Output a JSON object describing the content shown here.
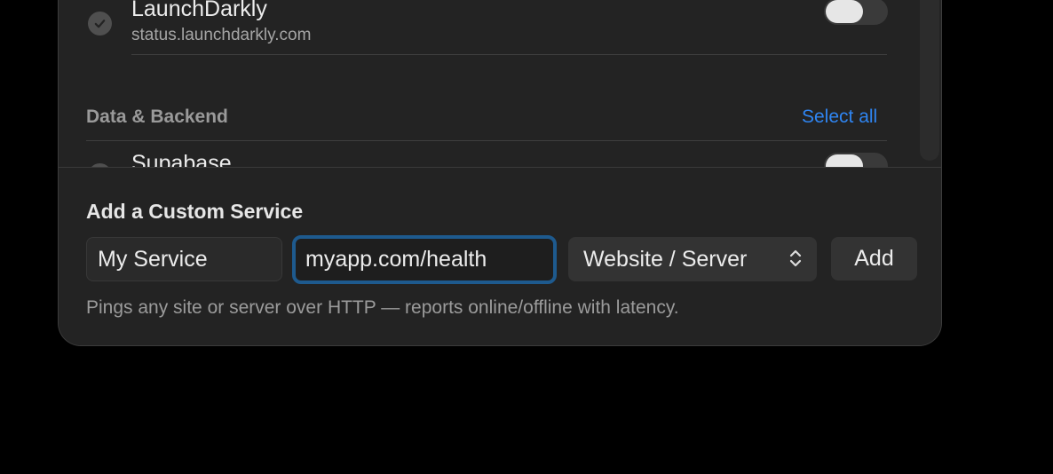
{
  "services": [
    {
      "name": "LaunchDarkly",
      "host": "status.launchdarkly.com",
      "enabled": false
    },
    {
      "name": "Supabase",
      "host": "",
      "enabled": false
    }
  ],
  "section": {
    "title": "Data & Backend",
    "select_all_label": "Select all"
  },
  "custom": {
    "title": "Add a Custom Service",
    "name_value": "My Service",
    "url_value": "myapp.com/health",
    "type_value": "Website / Server",
    "add_label": "Add",
    "hint": "Pings any site or server over HTTP — reports online/offline with latency."
  },
  "colors": {
    "accent": "#2f85f2",
    "focus_ring": "#1e5a8e",
    "background": "#232323"
  },
  "icons": {
    "check": "check-circle-icon",
    "chevrons": "up-down-chevron-icon"
  }
}
